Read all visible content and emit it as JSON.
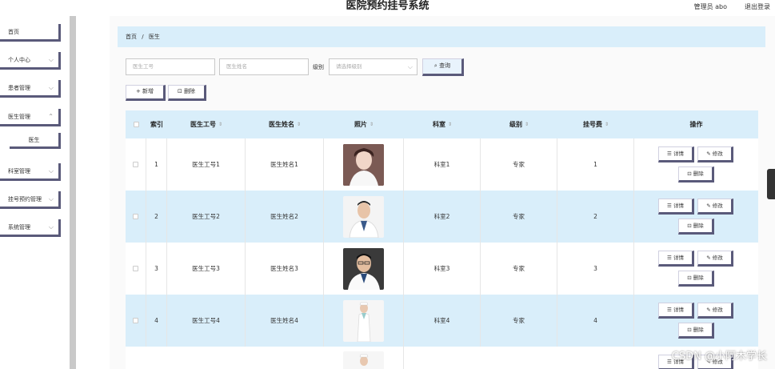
{
  "header": {
    "title": "医院预约挂号系统",
    "user": "管理员 abo",
    "logout": "退出登录"
  },
  "sidebar": {
    "items": [
      {
        "label": "首页",
        "chevron": false
      },
      {
        "label": "个人中心",
        "chevron": true
      },
      {
        "label": "患者管理",
        "chevron": true
      },
      {
        "label": "医生管理",
        "chevron": true
      },
      {
        "label": "医生",
        "sub": true
      },
      {
        "label": "科室管理",
        "chevron": true
      },
      {
        "label": "挂号预约管理",
        "chevron": true
      },
      {
        "label": "系统管理",
        "chevron": true
      }
    ]
  },
  "breadcrumb": {
    "home": "首页",
    "sep": "/",
    "current": "医生"
  },
  "search": {
    "doctor_id_placeholder": "医生工号",
    "doctor_name_placeholder": "医生姓名",
    "level_label": "级别",
    "level_placeholder": "请选择级别",
    "query_label": "⌕ 查询"
  },
  "toolbar": {
    "add_label": "+ 新增",
    "delete_label": "⊡ 删除"
  },
  "table": {
    "columns": [
      "",
      "索引",
      "医生工号",
      "医生姓名",
      "照片",
      "科室",
      "级别",
      "挂号费",
      "操作"
    ],
    "ops": {
      "detail": "☰ 详情",
      "edit": "✎ 修改",
      "delete": "⊡ 删除"
    },
    "rows": [
      {
        "index": "1",
        "doctor_id": "医生工号1",
        "doctor_name": "医生姓名1",
        "dept": "科室1",
        "level": "专家",
        "fee": "1"
      },
      {
        "index": "2",
        "doctor_id": "医生工号2",
        "doctor_name": "医生姓名2",
        "dept": "科室2",
        "level": "专家",
        "fee": "2"
      },
      {
        "index": "3",
        "doctor_id": "医生工号3",
        "doctor_name": "医生姓名3",
        "dept": "科室3",
        "level": "专家",
        "fee": "3"
      },
      {
        "index": "4",
        "doctor_id": "医生工号4",
        "doctor_name": "医生姓名4",
        "dept": "科室4",
        "level": "专家",
        "fee": "4"
      }
    ]
  },
  "watermark": "CSDN @小阿木学长",
  "colors": {
    "accent": "#d9eefa",
    "button_shadow": "#5a5a7a"
  }
}
